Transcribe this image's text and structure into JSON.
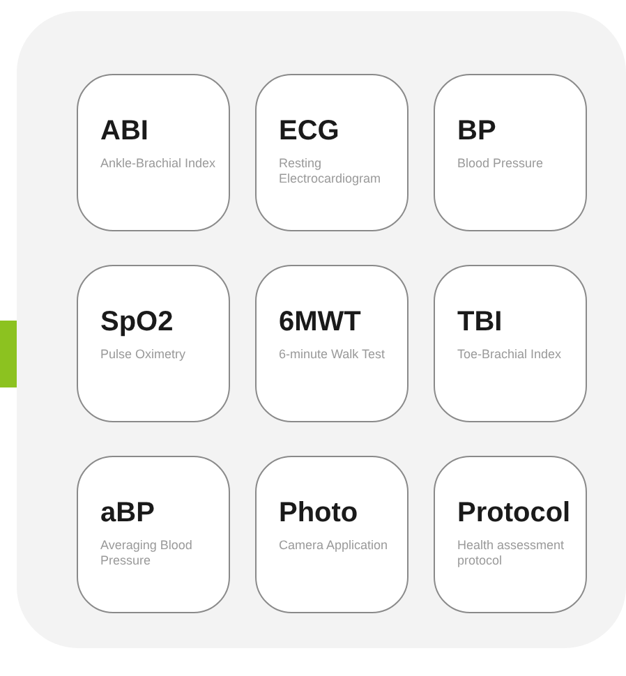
{
  "tiles": [
    {
      "title": "ABI",
      "subtitle": "Ankle-Brachial Index"
    },
    {
      "title": "ECG",
      "subtitle": "Resting Electrocardiogram"
    },
    {
      "title": "BP",
      "subtitle": "Blood Pressure"
    },
    {
      "title": "SpO2",
      "subtitle": "Pulse Oximetry"
    },
    {
      "title": "6MWT",
      "subtitle": "6-minute Walk Test"
    },
    {
      "title": "TBI",
      "subtitle": "Toe-Brachial Index"
    },
    {
      "title": "aBP",
      "subtitle": "Averaging Blood Pressure"
    },
    {
      "title": "Photo",
      "subtitle": "Camera Application"
    },
    {
      "title": "Protocol",
      "subtitle": "Health assessment protocol"
    }
  ]
}
